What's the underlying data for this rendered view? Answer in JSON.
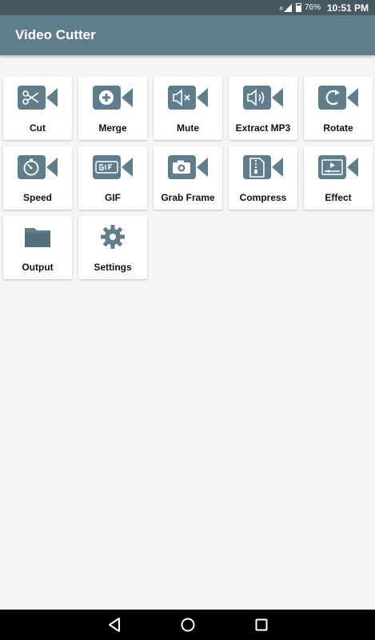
{
  "status_bar": {
    "roaming_label": "R",
    "battery": "76%",
    "time": "10:51 PM"
  },
  "app_bar": {
    "title": "Video Cutter"
  },
  "tools": [
    {
      "label": "Cut",
      "icon": "scissors-icon"
    },
    {
      "label": "Merge",
      "icon": "plus-icon"
    },
    {
      "label": "Mute",
      "icon": "mute-icon"
    },
    {
      "label": "Extract MP3",
      "icon": "speaker-icon"
    },
    {
      "label": "Rotate",
      "icon": "rotate-icon"
    },
    {
      "label": "Speed",
      "icon": "stopwatch-icon"
    },
    {
      "label": "GIF",
      "icon": "gif-icon"
    },
    {
      "label": "Grab Frame",
      "icon": "camera-icon"
    },
    {
      "label": "Compress",
      "icon": "zip-icon"
    },
    {
      "label": "Effect",
      "icon": "effect-icon"
    },
    {
      "label": "Output",
      "icon": "folder-icon"
    },
    {
      "label": "Settings",
      "icon": "gear-icon"
    }
  ],
  "colors": {
    "status_bar": "#465862",
    "app_bar": "#607d8b",
    "icon": "#607d8b",
    "background": "#f5f5f5"
  }
}
